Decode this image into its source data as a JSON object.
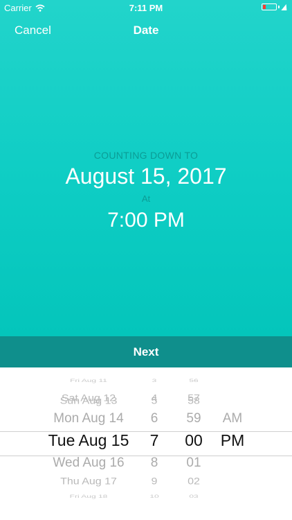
{
  "status_bar": {
    "carrier": "Carrier",
    "time": "7:11 PM",
    "wifi_icon": "wifi-icon",
    "battery_icon": "battery-low-icon",
    "battery_color": "#ff3b30"
  },
  "nav": {
    "cancel_label": "Cancel",
    "title": "Date"
  },
  "countdown": {
    "label": "COUNTING DOWN TO",
    "date": "August 15, 2017",
    "at_label": "At",
    "time": "7:00 PM"
  },
  "next_label": "Next",
  "colors": {
    "accent": "#0ecdc4",
    "next_bar": "#0f8f8c"
  },
  "picker": {
    "dates": [
      "Fri Aug 11",
      "Sat Aug 12",
      "Sun Aug 13",
      "Mon Aug 14",
      "Tue Aug 15",
      "Wed Aug 16",
      "Thu Aug 17",
      "Fri Aug 18"
    ],
    "hours": [
      "3",
      "4",
      "5",
      "6",
      "7",
      "8",
      "9",
      "10"
    ],
    "minutes": [
      "56",
      "57",
      "58",
      "59",
      "00",
      "01",
      "02",
      "03"
    ],
    "ampm": [
      "AM",
      "PM"
    ],
    "selected": {
      "date": "Tue Aug 15",
      "hour": "7",
      "minute": "00",
      "ampm": "PM"
    }
  }
}
